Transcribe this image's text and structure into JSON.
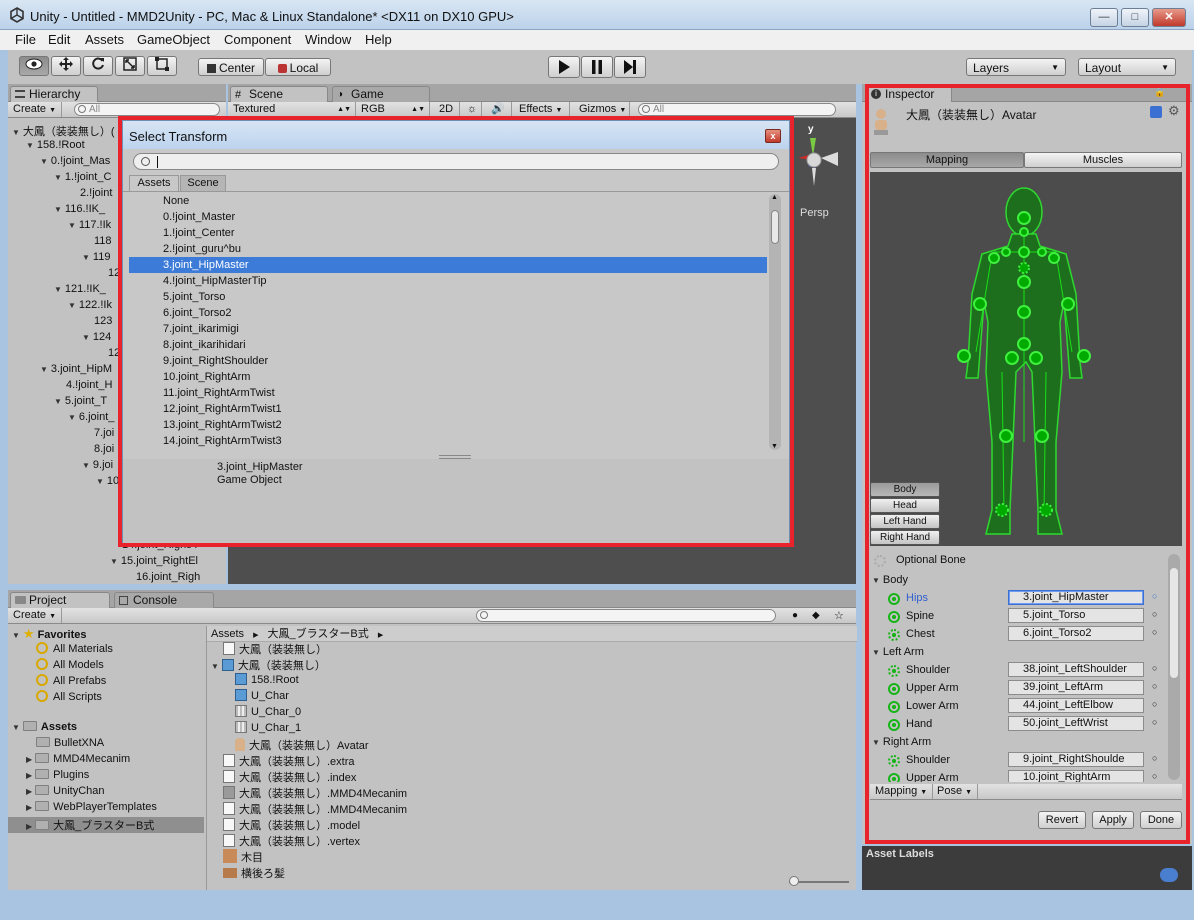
{
  "window": {
    "title": "Unity - Untitled - MMD2Unity - PC, Mac & Linux Standalone* <DX11 on DX10 GPU>",
    "min": "—",
    "max": "□",
    "close": "✕"
  },
  "menu": [
    "File",
    "Edit",
    "Assets",
    "GameObject",
    "Component",
    "Window",
    "Help"
  ],
  "toolbar": {
    "pivot": "Center",
    "space": "Local",
    "layers": "Layers",
    "layout": "Layout"
  },
  "hierarchy": {
    "tab": "Hierarchy",
    "create": "Create",
    "search": "All",
    "items": [
      "大鳳（装装無し）(",
      "158.!Root",
      "0.!joint_Mas",
      "1.!joint_C",
      "2.!joint",
      "116.!IK_",
      "117.!Ik",
      "118",
      "119",
      "12",
      "121.!IK_",
      "122.!Ik",
      "123",
      "124",
      "12",
      "3.joint_HipM",
      "4.!joint_H",
      "5.joint_T",
      "6.joint_",
      "7.joi",
      "8.joi",
      "9.joi",
      "10",
      "14.joint_RigntA",
      "15.joint_RightEl",
      "16.joint_Righ"
    ]
  },
  "scene": {
    "tab": "Scene",
    "gametab": "Game",
    "render": "Textured",
    "rgb": "RGB",
    "twod": "2D",
    "effects": "Effects",
    "gizmos": "Gizmos",
    "search": "All",
    "persp": "Persp",
    "axis_y": "y"
  },
  "dialog": {
    "title": "Select Transform",
    "close": "x",
    "search": "",
    "tab_assets": "Assets",
    "tab_scene": "Scene",
    "items": [
      "None",
      "0.!joint_Master",
      "1.!joint_Center",
      "2.!joint_guru^bu",
      "3.joint_HipMaster",
      "4.!joint_HipMasterTip",
      "5.joint_Torso",
      "6.joint_Torso2",
      "7.joint_ikarimigi",
      "8.joint_ikarihidari",
      "9.joint_RightShoulder",
      "10.joint_RightArm",
      "11.joint_RightArmTwist",
      "12.joint_RightArmTwist1",
      "13.joint_RightArmTwist2",
      "14.joint_RightArmTwist3"
    ],
    "preview_name": "3.joint_HipMaster",
    "preview_type": "Game Object"
  },
  "inspector": {
    "tab": "Inspector",
    "name": "大鳳（装装無し）Avatar",
    "mapping": "Mapping",
    "muscles": "Muscles",
    "partbtns": [
      "Body",
      "Head",
      "Left Hand",
      "Right Hand"
    ],
    "optional": "Optional Bone",
    "groups": [
      {
        "name": "Body",
        "bones": [
          {
            "label": "Hips",
            "value": "3.joint_HipMaster"
          },
          {
            "label": "Spine",
            "value": "5.joint_Torso"
          },
          {
            "label": "Chest",
            "value": "6.joint_Torso2"
          }
        ]
      },
      {
        "name": "Left Arm",
        "bones": [
          {
            "label": "Shoulder",
            "value": "38.joint_LeftShoulder"
          },
          {
            "label": "Upper Arm",
            "value": "39.joint_LeftArm"
          },
          {
            "label": "Lower Arm",
            "value": "44.joint_LeftElbow"
          },
          {
            "label": "Hand",
            "value": "50.joint_LeftWrist"
          }
        ]
      },
      {
        "name": "Right Arm",
        "bones": [
          {
            "label": "Shoulder",
            "value": "9.joint_RightShoulde"
          },
          {
            "label": "Upper Arm",
            "value": "10.joint_RightArm"
          }
        ]
      }
    ],
    "mapping_menu": "Mapping",
    "pose_menu": "Pose",
    "revert": "Revert",
    "apply": "Apply",
    "done": "Done",
    "asset_labels": "Asset Labels"
  },
  "project": {
    "tab": "Project",
    "console": "Console",
    "create": "Create",
    "favorites": "Favorites",
    "fav_items": [
      "All Materials",
      "All Models",
      "All Prefabs",
      "All Scripts"
    ],
    "assets": "Assets",
    "asset_items": [
      "BulletXNA",
      "MMD4Mecanim",
      "Plugins",
      "UnityChan",
      "WebPlayerTemplates",
      "大鳳_ブラスターB式"
    ],
    "breadcrumb": [
      "Assets",
      "大鳳_ブラスターB式"
    ],
    "files": [
      "大鳳（装装無し）",
      "大鳳（装装無し）",
      "158.!Root",
      "U_Char",
      "U_Char_0",
      "U_Char_1",
      "大鳳（装装無し）Avatar",
      "大鳳（装装無し）.extra",
      "大鳳（装装無し）.index",
      "大鳳（装装無し）.MMD4Mecanim",
      "大鳳（装装無し）.MMD4Mecanim",
      "大鳳（装装無し）.model",
      "大鳳（装装無し）.vertex",
      "木目",
      "横後ろ髪"
    ]
  }
}
